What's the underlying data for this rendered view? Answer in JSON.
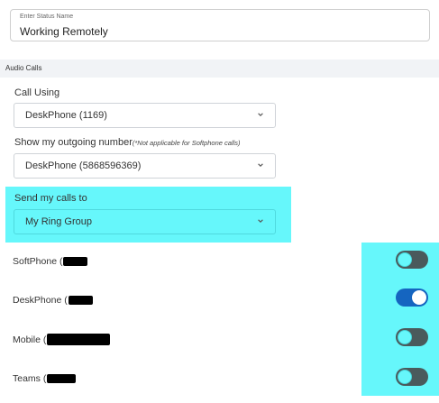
{
  "status": {
    "field_label": "Enter Status Name",
    "value": "Working Remotely"
  },
  "audio_calls": {
    "section_title": "Audio Calls",
    "call_using_label": "Call Using",
    "call_using_value": "DeskPhone (1169)",
    "outgoing_label": "Show my outgoing number",
    "outgoing_note": "(*Not applicable for Softphone calls)",
    "outgoing_value": "DeskPhone (5868596369)",
    "send_calls_label": "Send my calls to",
    "send_calls_value": "My Ring Group"
  },
  "devices": [
    {
      "label": "SoftPhone (",
      "enabled": false
    },
    {
      "label": "DeskPhone (",
      "enabled": true
    },
    {
      "label": "Mobile (",
      "enabled": false
    },
    {
      "label": "Teams (",
      "enabled": false
    }
  ],
  "colors": {
    "highlight": "#66f7fb",
    "toggle_on": "#1565c0",
    "toggle_off_track": "#4a5a5c"
  },
  "icons": {
    "dropdown": "chevron-down-icon"
  }
}
